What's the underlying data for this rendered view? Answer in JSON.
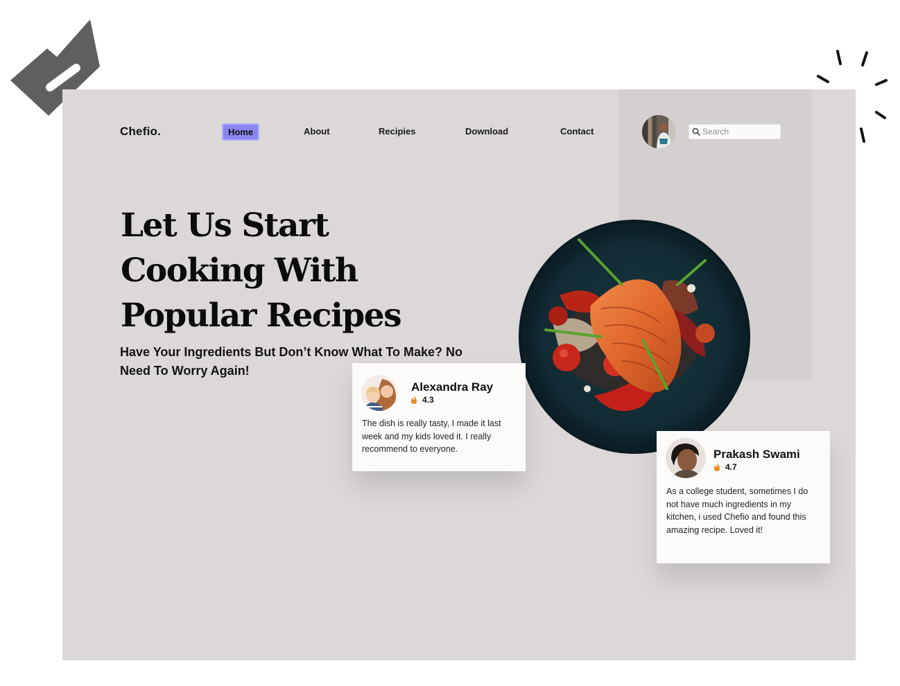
{
  "brand": {
    "name": "Chefio."
  },
  "nav": {
    "items": [
      {
        "label": "Home",
        "active": true
      },
      {
        "label": "About"
      },
      {
        "label": "Recipies"
      },
      {
        "label": "Download"
      },
      {
        "label": "Contact"
      }
    ]
  },
  "search": {
    "placeholder": "Search"
  },
  "hero": {
    "title": "Let Us Start Cooking With Popular Recipes",
    "subtitle": "Have Your Ingredients But Don’t Know What To Make? No Need To Worry Again!"
  },
  "reviews": [
    {
      "name": "Alexandra Ray",
      "rating": "4.3",
      "text": "The dish is really tasty, I made it last week and my kids loved it. I really recommend to everyone."
    },
    {
      "name": "Prakash Swami",
      "rating": "4.7",
      "text": "As a college student, sometimes I do not have much ingredients in my kitchen, i used Chefio and found this amazing recipe. Loved it!"
    }
  ],
  "colors": {
    "page_background": "#ffffff",
    "frame_background": "#dbd8d7",
    "side_panel": "#d3d0cf",
    "nav_active": "#8b85f0",
    "card_background": "#fcfbfa",
    "flame": "#f08a1c",
    "badge": "#5f5f5f"
  },
  "icons": [
    "badge-icon",
    "sparkle-icon",
    "search-icon",
    "flame-icon"
  ]
}
